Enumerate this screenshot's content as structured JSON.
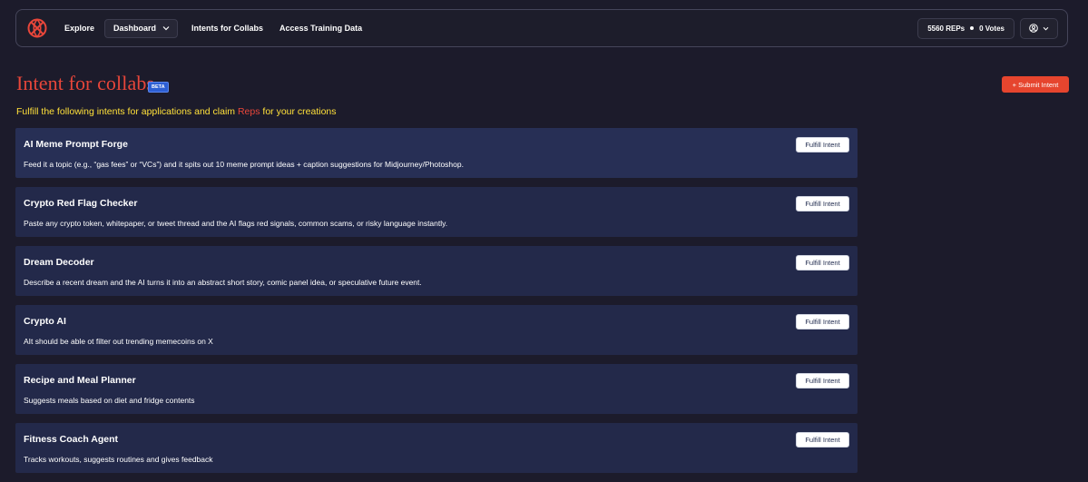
{
  "nav": {
    "links": [
      "Explore",
      "Dashboard",
      "Intents for Collabs",
      "Access Training Data"
    ],
    "reps": "5560 REPs",
    "votes": "0 Votes"
  },
  "header": {
    "title": "Intent for collabs",
    "badge": "BETA",
    "submit_label": "+ Submit Intent",
    "subtitle_pre": "Fulfill the following intents for applications and claim ",
    "subtitle_reps": "Reps",
    "subtitle_post": " for your creations"
  },
  "colors": {
    "accent": "#e8463a",
    "subtitle": "#ffe03a",
    "background": "#1c1b2b",
    "card": "#23294a"
  },
  "intents": [
    {
      "title": "AI Meme Prompt Forge",
      "desc": "Feed it a topic (e.g., “gas fees” or “VCs”) and it spits out 10 meme prompt ideas + caption suggestions for Midjourney/Photoshop.",
      "button": "Fulfill Intent"
    },
    {
      "title": "Crypto Red Flag Checker",
      "desc": "Paste any crypto token, whitepaper, or tweet thread and the AI flags red signals, common scams, or risky language instantly.",
      "button": "Fulfill Intent"
    },
    {
      "title": "Dream Decoder",
      "desc": "Describe a recent dream and the AI turns it into an abstract short story, comic panel idea, or speculative future event.",
      "button": "Fulfill Intent"
    },
    {
      "title": "Crypto AI",
      "desc": "AIt should be able ot filter out trending memecoins on X",
      "button": "Fulfill Intent"
    },
    {
      "title": "Recipe and Meal Planner",
      "desc": "Suggests meals based on diet and fridge contents",
      "button": "Fulfill Intent"
    },
    {
      "title": "Fitness Coach Agent",
      "desc": "Tracks workouts, suggests routines and gives feedback",
      "button": "Fulfill Intent"
    }
  ]
}
